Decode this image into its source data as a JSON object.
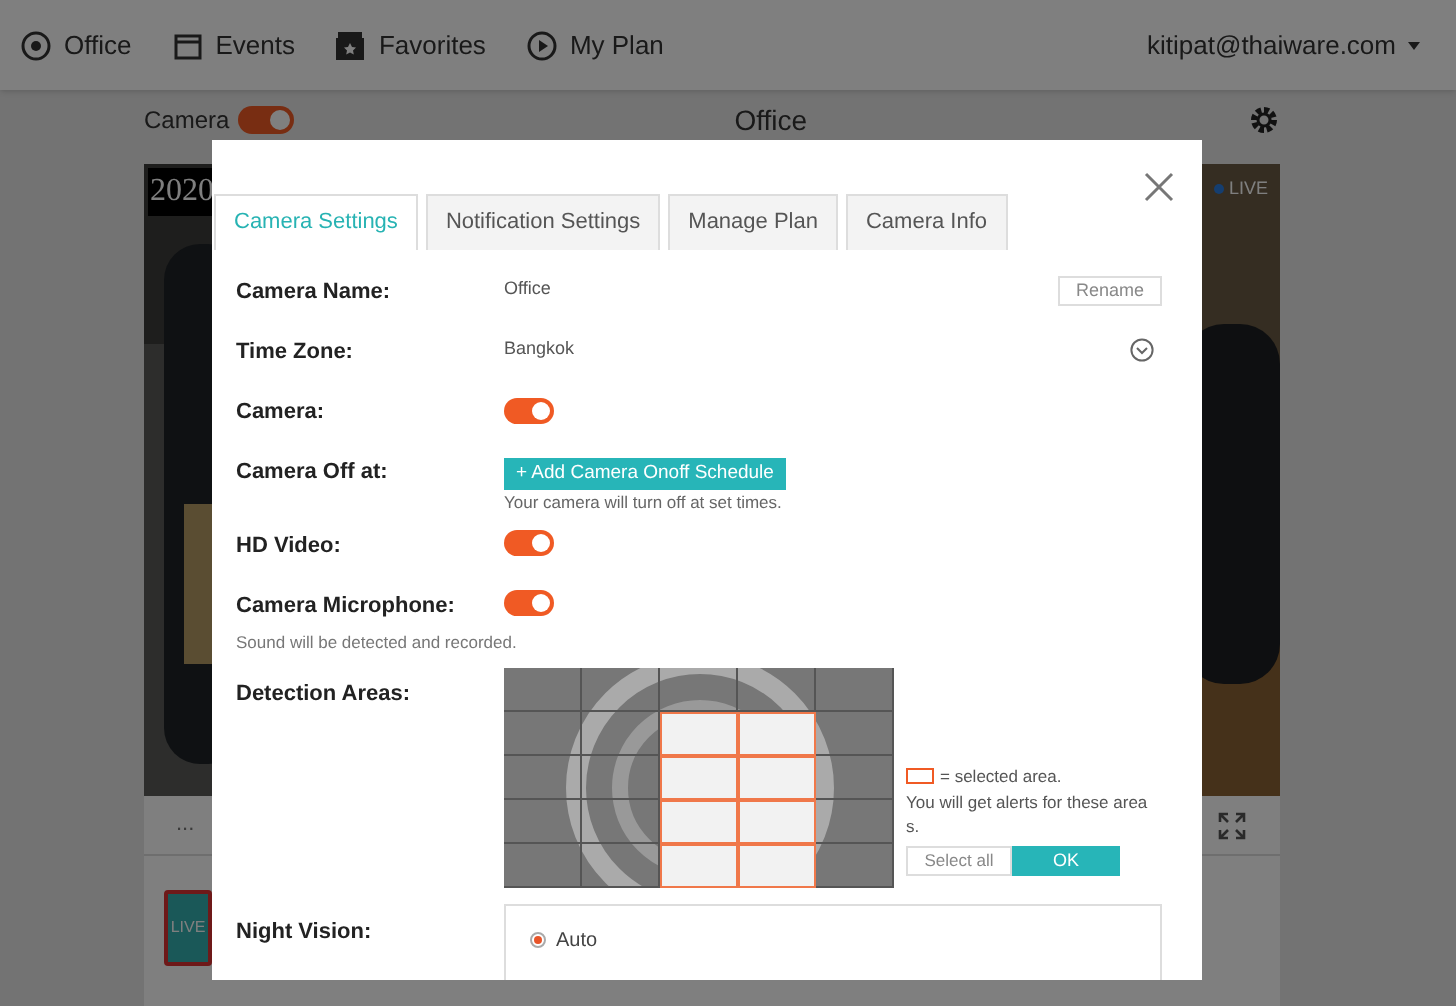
{
  "nav": {
    "items": [
      {
        "label": "Office",
        "kind": "camera"
      },
      {
        "label": "Events",
        "kind": "events"
      },
      {
        "label": "Favorites",
        "kind": "favorites"
      },
      {
        "label": "My Plan",
        "kind": "plan"
      }
    ],
    "account": "kitipat@thaiware.com"
  },
  "camera_panel": {
    "camera_label": "Camera",
    "camera_on": true,
    "title": "Office",
    "video": {
      "timestamp": "2020",
      "live": "LIVE"
    },
    "footer": "...",
    "thumbnail": {
      "label": "LIVE"
    }
  },
  "dialog": {
    "tabs": [
      {
        "label": "Camera Settings",
        "selected": true
      },
      {
        "label": "Notification Settings",
        "selected": false
      },
      {
        "label": "Manage Plan",
        "selected": false
      },
      {
        "label": "Camera Info",
        "selected": false
      }
    ],
    "rows": [
      {
        "kind": "text",
        "label": "Camera Name:",
        "value": "Office",
        "button": "Rename"
      },
      {
        "kind": "select",
        "label": "Time Zone:",
        "value": "Bangkok"
      },
      {
        "kind": "toggle",
        "label": "Camera:",
        "on": true
      },
      {
        "kind": "action",
        "label": "Camera Off at:",
        "button": "+ Add Camera Onoff Schedule",
        "hint": "Your camera will turn off at set times."
      },
      {
        "kind": "toggle",
        "label": "HD Video:",
        "on": true
      },
      {
        "kind": "toggle",
        "label": "Camera Microphone:",
        "on": true,
        "hint": "Sound will be detected and recorded."
      }
    ],
    "detection": {
      "label": "Detection Areas:",
      "grid": [
        {
          "cells": [
            {
              "selected": false
            },
            {
              "selected": false
            },
            {
              "selected": false
            },
            {
              "selected": false
            },
            {
              "selected": false
            }
          ]
        },
        {
          "cells": [
            {
              "selected": false
            },
            {
              "selected": false
            },
            {
              "selected": true
            },
            {
              "selected": true
            },
            {
              "selected": false
            }
          ]
        },
        {
          "cells": [
            {
              "selected": false
            },
            {
              "selected": false
            },
            {
              "selected": true
            },
            {
              "selected": true
            },
            {
              "selected": false
            }
          ]
        },
        {
          "cells": [
            {
              "selected": false
            },
            {
              "selected": false
            },
            {
              "selected": true
            },
            {
              "selected": true
            },
            {
              "selected": false
            }
          ]
        },
        {
          "cells": [
            {
              "selected": false
            },
            {
              "selected": false
            },
            {
              "selected": true
            },
            {
              "selected": true
            },
            {
              "selected": false
            }
          ]
        }
      ],
      "legend": "= selected area.",
      "note": "You will get alerts for these area s.",
      "select_all": "Select all",
      "ok": "OK"
    },
    "night_vision": {
      "label": "Night Vision:",
      "options": [
        {
          "label": "Auto",
          "selected": true
        }
      ]
    }
  }
}
